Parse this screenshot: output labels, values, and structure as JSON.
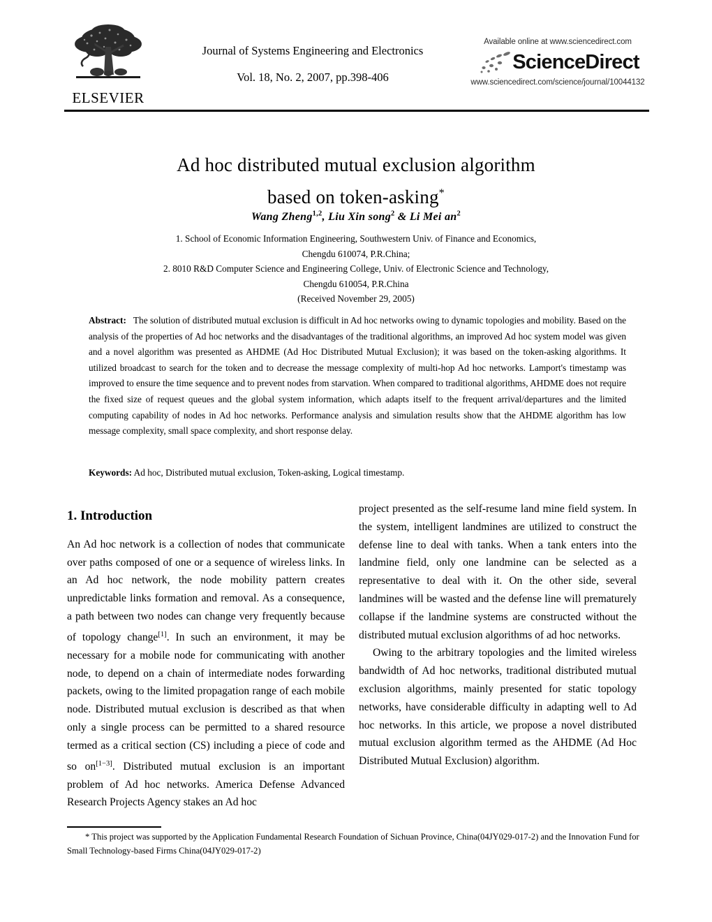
{
  "masthead": {
    "publisher_logo": {
      "name": "elsevier-tree-logo",
      "wordmark": "ELSEVIER"
    },
    "journal_title": "Journal of Systems Engineering and Electronics",
    "journal_volume_line": "Vol. 18, No. 2, 2007, pp.398-406",
    "sciencedirect": {
      "available_line": "Available online at www.sciencedirect.com",
      "brand": "ScienceDirect",
      "url_line": "www.sciencedirect.com/science/journal/10044132"
    }
  },
  "article": {
    "title_line_1": "Ad hoc distributed mutual exclusion algorithm",
    "title_line_2": "based on token-asking",
    "title_footnote_marker": "*",
    "authors": [
      {
        "name": "Wang Zheng",
        "sup": "1,2",
        "sep": ", "
      },
      {
        "name": "Liu Xin song",
        "sup": "2",
        "sep": " & "
      },
      {
        "name": "Li Mei an",
        "sup": "2",
        "sep": ""
      }
    ],
    "affiliations": [
      "1. School of Economic Information Engineering, Southwestern Univ. of Finance and Economics,",
      "Chengdu 610074, P.R.China;",
      "2. 8010 R&D Computer Science and Engineering College, Univ. of Electronic Science and Technology,",
      "Chengdu 610054, P.R.China"
    ],
    "received": "(Received November 29, 2005)"
  },
  "abstract": {
    "label": "Abstract:",
    "text": "The solution of distributed mutual exclusion is difficult in Ad hoc networks owing to dynamic topologies and mobility. Based on the analysis of the properties of Ad hoc networks and the disadvantages of the traditional algorithms, an improved Ad hoc system model was given and a novel algorithm was presented as AHDME (Ad Hoc Distributed Mutual Exclusion); it was based on the token-asking algorithms. It utilized broadcast to search for the token and to decrease the message complexity of multi-hop Ad hoc networks. Lamport's timestamp was improved to ensure the time sequence and to prevent nodes from starvation. When compared to traditional algorithms, AHDME does not require the fixed size of request queues and the global system information, which adapts itself to the frequent arrival/departures and the limited computing capability of nodes in Ad hoc networks. Performance analysis and simulation results show that the AHDME algorithm has low message complexity, small space complexity, and short response delay."
  },
  "keywords": {
    "label": "Keywords:",
    "text": "Ad hoc, Distributed mutual exclusion, Token-asking, Logical timestamp."
  },
  "body": {
    "section_heading": "1. Introduction",
    "left_paragraph_1_a": "An Ad hoc network is a collection of nodes that communicate over paths composed of one or a sequence of wireless links. In an Ad hoc network, the node mobility pattern creates unpredictable links formation and removal. As a consequence, a path between two nodes can change very frequently because of topology change",
    "left_ref_1": "[1]",
    "left_paragraph_1_b": ". In such an environment, it may be necessary for a mobile node for communicating with another node, to depend on a chain of intermediate nodes forwarding packets, owing to the limited propagation range of each mobile node. Distributed mutual exclusion is described as that when only a single process can be permitted to a shared resource termed as a critical section (CS) including a piece of code and so on",
    "left_ref_2": "[1−3]",
    "left_paragraph_1_c": ". Distributed mutual exclusion is an important problem of Ad hoc networks. America Defense Advanced Research Projects Agency stakes an Ad hoc",
    "right_paragraph_1": "project presented as the self-resume land mine field system. In the system, intelligent landmines are utilized to construct the defense line to deal with tanks. When a tank enters into the landmine field, only one landmine can be selected as a representative to deal with it. On the other side, several landmines will be wasted and the defense line will prematurely collapse if the landmine systems are constructed without the distributed mutual exclusion algorithms of ad hoc networks.",
    "right_paragraph_2": "Owing to the arbitrary topologies and the limited wireless bandwidth of Ad hoc networks, traditional distributed mutual exclusion algorithms, mainly presented for static topology networks, have considerable difficulty in adapting well to Ad hoc networks. In this article, we propose a novel distributed mutual exclusion algorithm termed as the AHDME (Ad Hoc Distributed Mutual Exclusion) algorithm."
  },
  "footnote": {
    "marker": "*",
    "line_1": "This project was supported by the Application Fundamental Research Foundation of Sichuan Province, China(04JY029-017-2)",
    "line_2": "and the Innovation Fund for Small Technology-based Firms China(04JY029-017-2)"
  },
  "colors": {
    "text": "#000000",
    "background": "#ffffff",
    "rule": "#000000"
  }
}
